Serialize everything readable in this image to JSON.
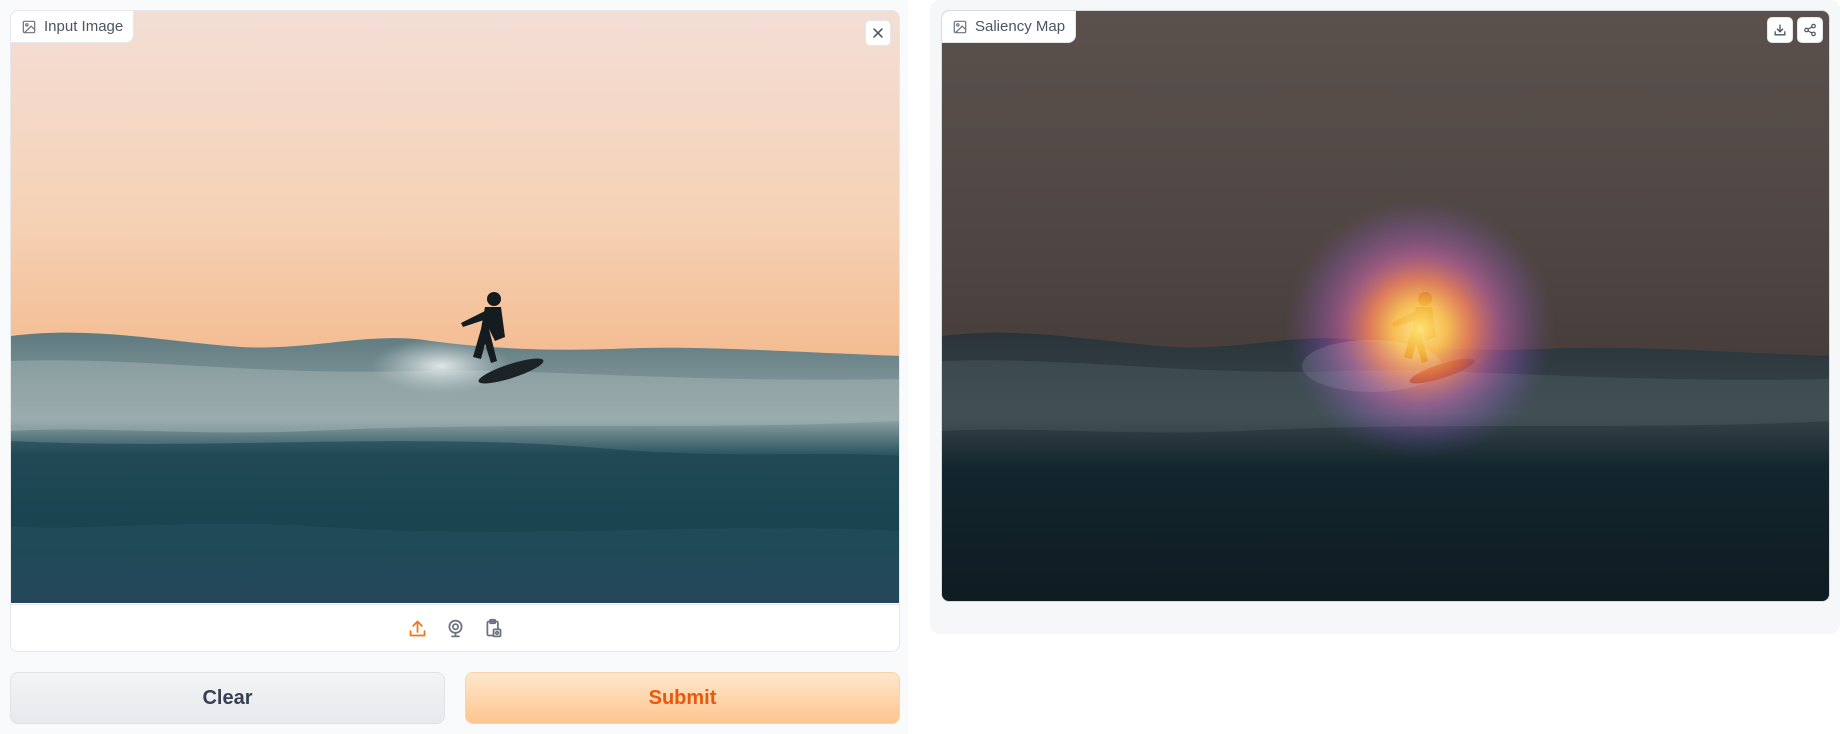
{
  "input": {
    "label": "Input Image",
    "label_icon": "image-icon",
    "close_icon": "close-icon",
    "sources": [
      {
        "name": "upload-icon",
        "color": "#f97316"
      },
      {
        "name": "webcam-icon",
        "color": "#6b7280"
      },
      {
        "name": "clipboard-icon",
        "color": "#6b7280"
      }
    ]
  },
  "output": {
    "label": "Saliency Map",
    "label_icon": "image-icon",
    "actions": [
      "download-icon",
      "share-icon"
    ]
  },
  "buttons": {
    "clear_label": "Clear",
    "submit_label": "Submit"
  },
  "colors": {
    "accent": "#ea580c",
    "submit_bg_top": "#ffe7cc",
    "submit_bg_bottom": "#fdc58f"
  }
}
